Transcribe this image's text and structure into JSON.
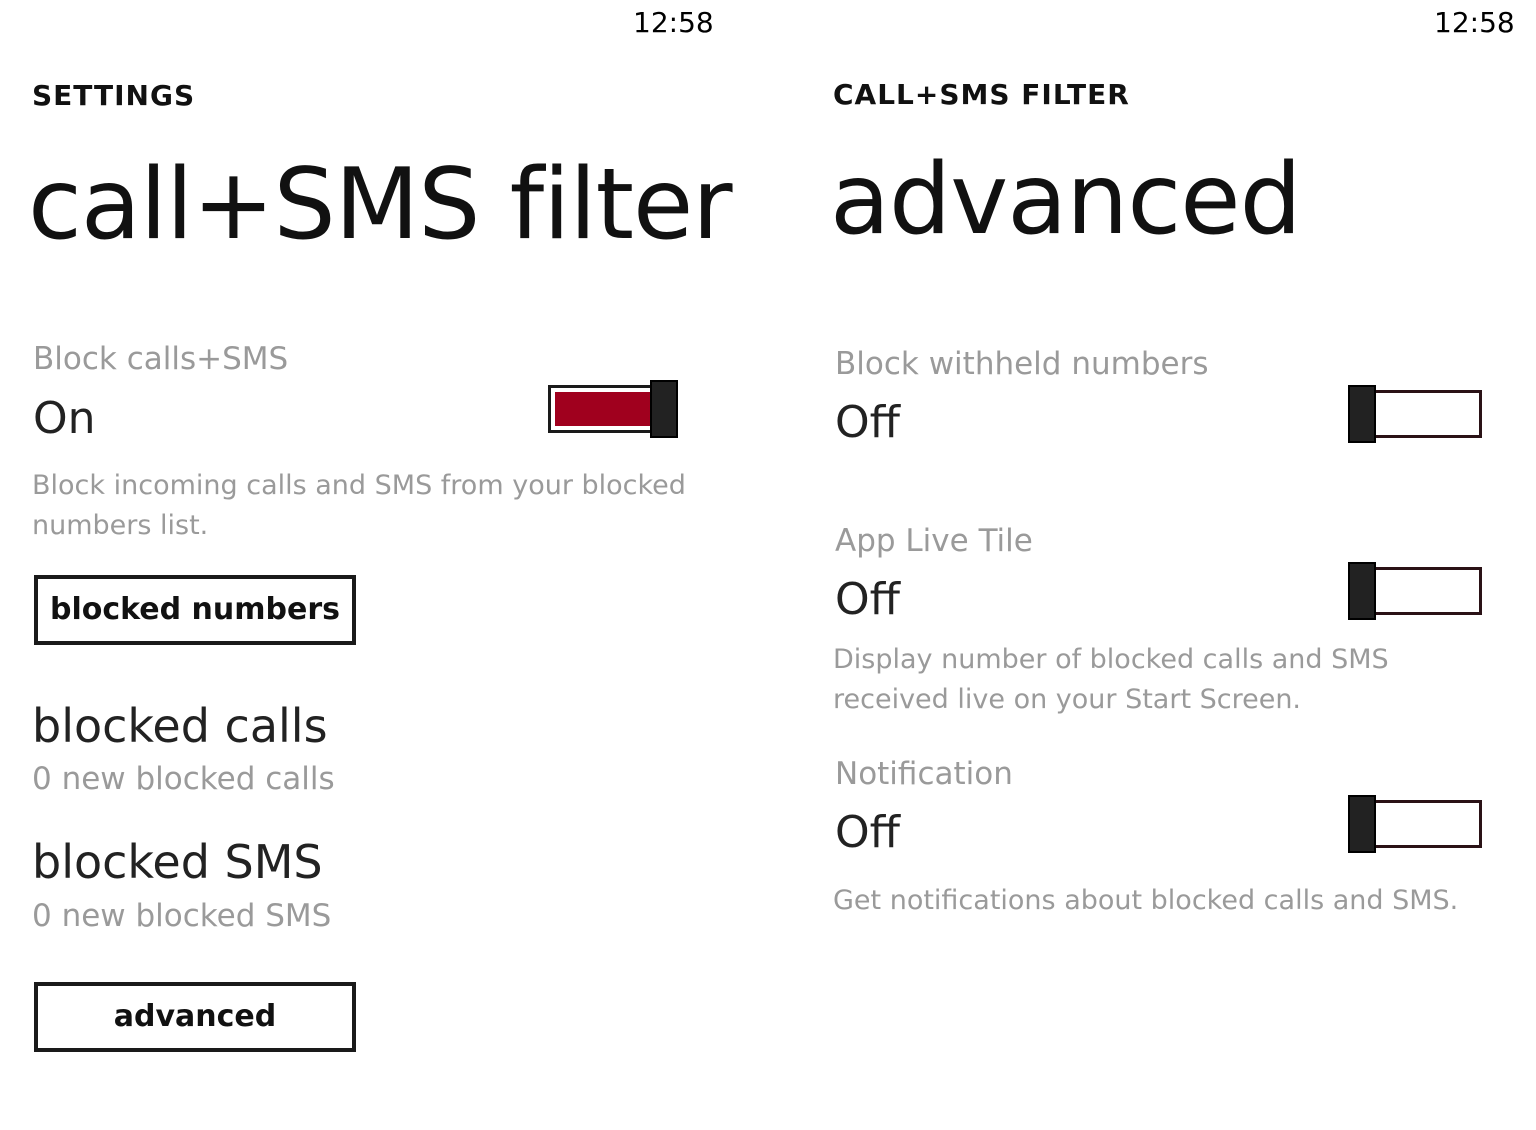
{
  "left_screen": {
    "clock": "12:58",
    "app_title": "SETTINGS",
    "page_title": "call+SMS filter",
    "block_toggle": {
      "header": "Block calls+SMS",
      "state": "On",
      "is_on": true,
      "accent_color": "#a0001e"
    },
    "block_description": "Block incoming calls and SMS from your blocked numbers list.",
    "blocked_numbers_button": "blocked numbers",
    "blocked_calls": {
      "title": "blocked calls",
      "subtitle": "0 new blocked calls"
    },
    "blocked_sms": {
      "title": "blocked SMS",
      "subtitle": "0 new blocked SMS"
    },
    "advanced_button": "advanced"
  },
  "right_screen": {
    "clock": "12:58",
    "app_title": "CALL+SMS FILTER",
    "page_title": "advanced",
    "withheld_toggle": {
      "header": "Block withheld numbers",
      "state": "Off",
      "is_on": false
    },
    "live_tile_toggle": {
      "header": "App Live Tile",
      "state": "Off",
      "is_on": false
    },
    "live_tile_description": "Display number of blocked calls and SMS received live on your Start Screen.",
    "notification_toggle": {
      "header": "Notification",
      "state": "Off",
      "is_on": false
    },
    "notification_description": "Get notifications about blocked calls and SMS."
  }
}
